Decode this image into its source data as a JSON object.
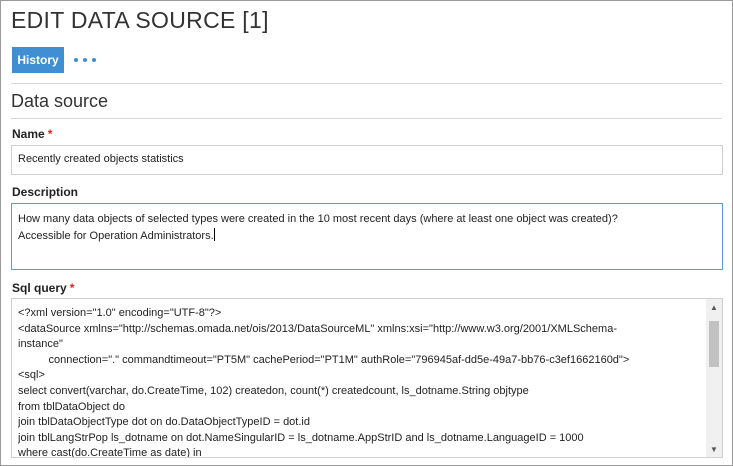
{
  "header": {
    "title": "EDIT DATA SOURCE [1]"
  },
  "toolbar": {
    "history_label": "History",
    "more_icon": "ellipsis-icon"
  },
  "section": {
    "title": "Data source"
  },
  "form": {
    "name": {
      "label": "Name",
      "required_mark": "*",
      "value": "Recently created objects statistics"
    },
    "description": {
      "label": "Description",
      "value_line1": "How many data objects of selected types were created in the 10 most recent days (where at least one object was created)?",
      "value_line2": "Accessible for Operation Administrators."
    },
    "sql_query": {
      "label": "Sql query",
      "required_mark": "*",
      "lines": [
        "<?xml version=\"1.0\" encoding=\"UTF-8\"?>",
        "<dataSource xmlns=\"http://schemas.omada.net/ois/2013/DataSourceML\" xmlns:xsi=\"http://www.w3.org/2001/XMLSchema-",
        "instance\"",
        "          connection=\".\" commandtimeout=\"PT5M\" cachePeriod=\"PT1M\" authRole=\"796945af-dd5e-49a7-bb76-c3ef1662160d\">",
        "<sql>",
        "select convert(varchar, do.CreateTime, 102) createdon, count(*) createdcount, ls_dotname.String objtype",
        "from tblDataObject do",
        "join tblDataObjectType dot on do.DataObjectTypeID = dot.id",
        "join tblLangStrPop ls_dotname on dot.NameSingularID = ls_dotname.AppStrID and ls_dotname.LanguageID = 1000",
        "where cast(do.CreateTime as date) in"
      ]
    }
  },
  "colors": {
    "accent": "#3f8fd2",
    "required": "#d9261c",
    "focus_border": "#5b9bd5"
  }
}
